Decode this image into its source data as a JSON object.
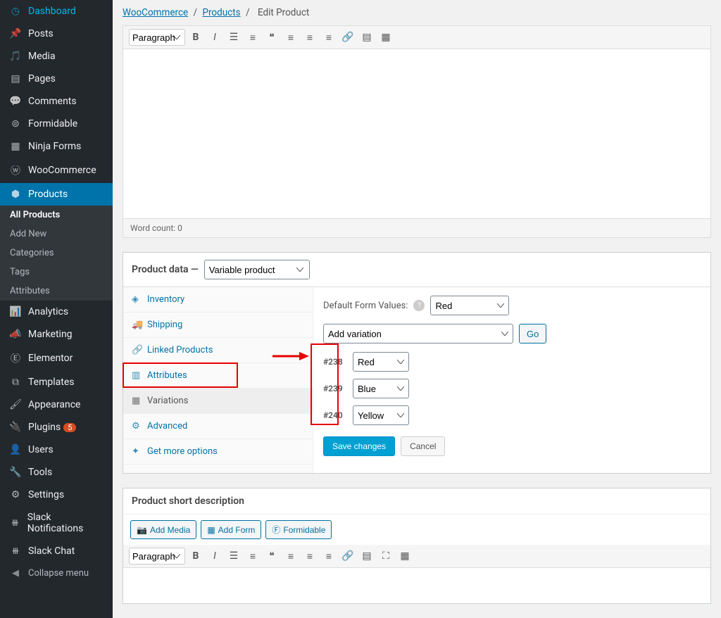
{
  "sidebar": {
    "items": [
      {
        "icon": "gauge",
        "label": "Dashboard"
      },
      {
        "icon": "pin",
        "label": "Posts"
      },
      {
        "icon": "media",
        "label": "Media"
      },
      {
        "icon": "page",
        "label": "Pages"
      },
      {
        "icon": "comment",
        "label": "Comments"
      },
      {
        "icon": "form",
        "label": "Formidable"
      },
      {
        "icon": "ninja",
        "label": "Ninja Forms"
      },
      {
        "icon": "woo",
        "label": "WooCommerce"
      },
      {
        "icon": "cube",
        "label": "Products",
        "active": true
      },
      {
        "icon": "chart",
        "label": "Analytics"
      },
      {
        "icon": "megaphone",
        "label": "Marketing"
      },
      {
        "icon": "elementor",
        "label": "Elementor"
      },
      {
        "icon": "templates",
        "label": "Templates"
      },
      {
        "icon": "brush",
        "label": "Appearance"
      },
      {
        "icon": "plug",
        "label": "Plugins",
        "badge": "5"
      },
      {
        "icon": "user",
        "label": "Users"
      },
      {
        "icon": "wrench",
        "label": "Tools"
      },
      {
        "icon": "gear",
        "label": "Settings"
      },
      {
        "icon": "slack",
        "label": "Slack Notifications"
      },
      {
        "icon": "slack",
        "label": "Slack Chat"
      }
    ],
    "submenu": [
      {
        "label": "All Products",
        "active": true
      },
      {
        "label": "Add New"
      },
      {
        "label": "Categories"
      },
      {
        "label": "Tags"
      },
      {
        "label": "Attributes"
      }
    ],
    "collapse": "Collapse menu"
  },
  "breadcrumb": {
    "part1": "WooCommerce",
    "part2": "Products",
    "part3": "Edit Product",
    "sep": "/"
  },
  "editor": {
    "format": "Paragraph",
    "word_count": "Word count: 0"
  },
  "product_data": {
    "title": "Product data —",
    "type": "Variable product",
    "tabs": [
      {
        "icon": "inventory",
        "label": "Inventory"
      },
      {
        "icon": "shipping",
        "label": "Shipping"
      },
      {
        "icon": "link",
        "label": "Linked Products"
      },
      {
        "icon": "attrs",
        "label": "Attributes"
      },
      {
        "icon": "grid",
        "label": "Variations",
        "selected": true
      },
      {
        "icon": "gear",
        "label": "Advanced"
      },
      {
        "icon": "ext",
        "label": "Get more options"
      }
    ],
    "default_values_label": "Default Form Values:",
    "default_value": "Red",
    "add_variation": "Add variation",
    "go": "Go",
    "variations": [
      {
        "id": "#238",
        "value": "Red"
      },
      {
        "id": "#239",
        "value": "Blue"
      },
      {
        "id": "#240",
        "value": "Yellow"
      }
    ],
    "save": "Save changes",
    "cancel": "Cancel"
  },
  "short_desc": {
    "title": "Product short description",
    "add_media": "Add Media",
    "add_form": "Add Form",
    "formidable": "Formidable",
    "format": "Paragraph"
  }
}
